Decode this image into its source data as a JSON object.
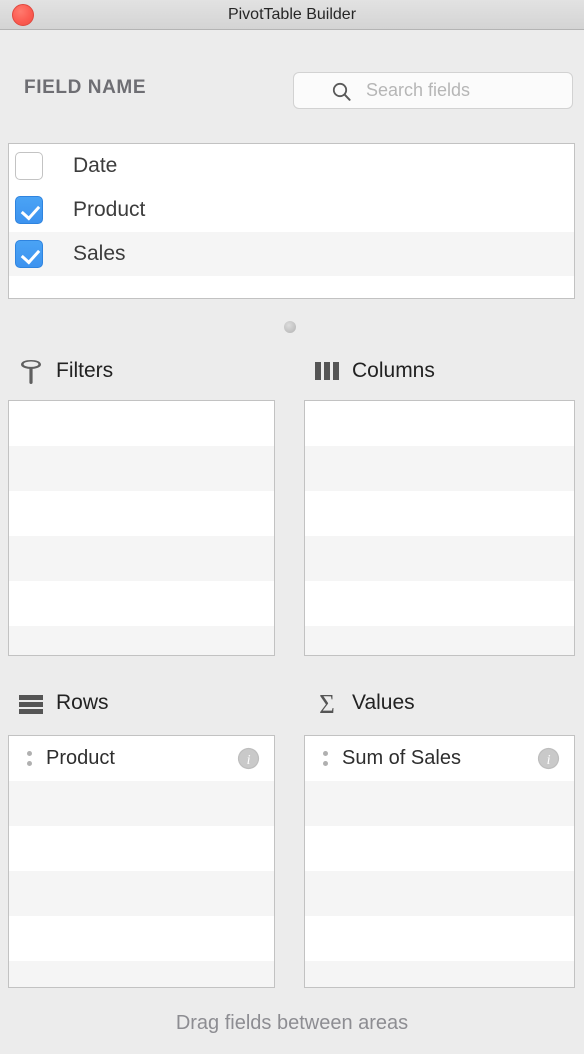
{
  "window": {
    "title": "PivotTable Builder",
    "close_button": "close",
    "accent_checkbox_color": "#3d93ef",
    "background_color": "#ececec"
  },
  "header": {
    "field_name_label": "FIELD NAME",
    "search": {
      "placeholder": "Search fields",
      "value": "",
      "icon": "search-icon"
    }
  },
  "field_list": {
    "items": [
      {
        "label": "Date",
        "checked": false
      },
      {
        "label": "Product",
        "checked": true
      },
      {
        "label": "Sales",
        "checked": true
      }
    ]
  },
  "areas": [
    {
      "key": "filters",
      "title": "Filters",
      "icon": "funnel-icon",
      "chips": []
    },
    {
      "key": "columns",
      "title": "Columns",
      "icon": "columns-icon",
      "chips": []
    },
    {
      "key": "rows",
      "title": "Rows",
      "icon": "rows-icon",
      "chips": [
        {
          "label": "Product",
          "info": "info-icon",
          "handle": "drag-handle-icon"
        }
      ]
    },
    {
      "key": "values",
      "title": "Values",
      "icon": "sigma-icon",
      "chips": [
        {
          "label": "Sum of Sales",
          "info": "info-icon",
          "handle": "drag-handle-icon"
        }
      ]
    }
  ],
  "footer": {
    "hint": "Drag fields between areas"
  }
}
